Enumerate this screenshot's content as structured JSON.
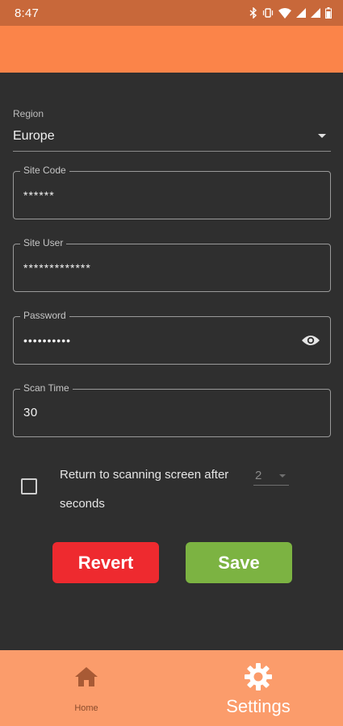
{
  "status_bar": {
    "time": "8:47",
    "icons": [
      "bluetooth-icon",
      "vibrate-icon",
      "wifi-icon",
      "signal-icon",
      "signal-icon",
      "battery-icon"
    ]
  },
  "form": {
    "region": {
      "label": "Region",
      "value": "Europe"
    },
    "site_code": {
      "label": "Site Code",
      "value": "******"
    },
    "site_user": {
      "label": "Site User",
      "value": "*************"
    },
    "password": {
      "label": "Password",
      "value": "••••••••••",
      "toggle_icon": "eye-icon"
    },
    "scan_time": {
      "label": "Scan Time",
      "value": "30"
    },
    "return_option": {
      "text_before": "Return to scanning screen after",
      "selected_value": "2",
      "text_after": "seconds",
      "checked": false
    }
  },
  "buttons": {
    "revert": "Revert",
    "save": "Save"
  },
  "bottom_nav": {
    "home_label": "Home",
    "settings_label": "Settings",
    "active": "Settings"
  },
  "colors": {
    "app_bar": "#fb8449",
    "status_bar": "#c8683a",
    "background": "#2f2f2f",
    "bottom_nav": "#fb9c6b",
    "revert": "#ee2a2f",
    "save": "#7cb342"
  }
}
